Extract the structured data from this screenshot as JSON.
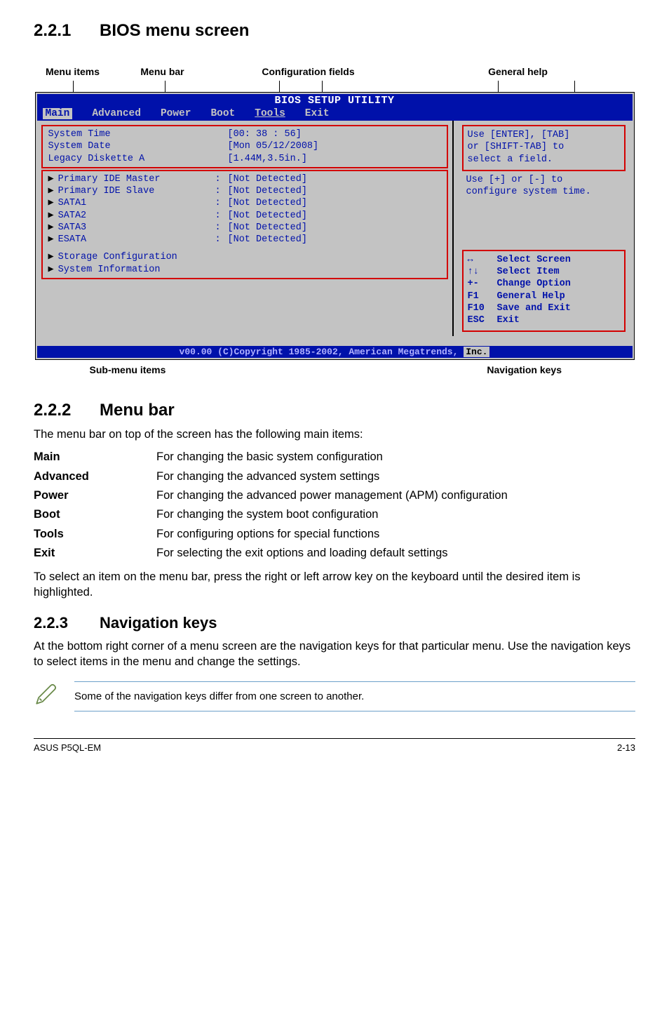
{
  "section_221": {
    "num": "2.2.1",
    "title": "BIOS menu screen"
  },
  "labels_top": {
    "menu_items": "Menu items",
    "menu_bar": "Menu bar",
    "config_fields": "Configuration fields",
    "general_help": "General help"
  },
  "bios": {
    "title": "BIOS SETUP UTILITY",
    "menubar": [
      "Main",
      "Advanced",
      "Power",
      "Boot",
      "Tools",
      "Exit"
    ],
    "left_group1": [
      {
        "k": "System Time",
        "v": "[00: 38 : 56]",
        "c": ""
      },
      {
        "k": "System Date",
        "v": "[Mon 05/12/2008]",
        "c": ""
      },
      {
        "k": "Legacy Diskette A",
        "v": "[1.44M,3.5in.]",
        "c": ""
      }
    ],
    "left_group2": [
      {
        "k": "Primary IDE Master",
        "v": "[Not Detected]",
        "arrow": true,
        "c": ":"
      },
      {
        "k": "Primary IDE Slave",
        "v": "[Not Detected]",
        "arrow": true,
        "c": ":"
      },
      {
        "k": "SATA1",
        "v": "[Not Detected]",
        "arrow": true,
        "c": ":"
      },
      {
        "k": "SATA2",
        "v": "[Not Detected]",
        "arrow": true,
        "c": ":"
      },
      {
        "k": "SATA3",
        "v": "[Not Detected]",
        "arrow": true,
        "c": ":"
      },
      {
        "k": "ESATA",
        "v": "[Not Detected]",
        "arrow": true,
        "c": ":"
      }
    ],
    "left_group3": [
      {
        "k": "Storage Configuration",
        "arrow": true
      },
      {
        "k": "System Information",
        "arrow": true
      }
    ],
    "help1": [
      "Use [ENTER], [TAB]",
      "or [SHIFT-TAB] to",
      "select a field."
    ],
    "help2": [
      "Use [+] or [-] to",
      "configure system time."
    ],
    "keys": [
      {
        "sym": "↔",
        "label": "Select Screen"
      },
      {
        "sym": "↑↓",
        "label": "Select Item"
      },
      {
        "sym": "+-",
        "label": "Change Option"
      },
      {
        "sym": "F1",
        "label": "General Help"
      },
      {
        "sym": "F10",
        "label": "Save and Exit"
      },
      {
        "sym": "ESC",
        "label": "Exit"
      }
    ],
    "copyright_pre": "v00.00 (C)Copyright 1985-2002, American Megatrends, ",
    "copyright_inc": "Inc."
  },
  "labels_bottom": {
    "sub_menu": "Sub-menu items",
    "nav_keys": "Navigation keys"
  },
  "section_222": {
    "num": "2.2.2",
    "title": "Menu bar",
    "intro": "The menu bar on top of the screen has the following main items:",
    "defs": [
      {
        "term": "Main",
        "desc": "For changing the basic system configuration"
      },
      {
        "term": "Advanced",
        "desc": "For changing the advanced system settings"
      },
      {
        "term": "Power",
        "desc": "For changing the advanced power management (APM) configuration"
      },
      {
        "term": "Boot",
        "desc": "For changing the system boot configuration"
      },
      {
        "term": "Tools",
        "desc": "For configuring options for special functions"
      },
      {
        "term": "Exit",
        "desc": "For selecting the exit options and loading default settings"
      }
    ],
    "outro": "To select an item on the menu bar, press the right or left arrow key on the keyboard until the desired item is highlighted."
  },
  "section_223": {
    "num": "2.2.3",
    "title": "Navigation keys",
    "body": "At the bottom right corner of a menu screen are the navigation keys for that particular menu. Use the navigation keys to select items in the menu and change the settings.",
    "note": "Some of the navigation keys differ from one screen to another."
  },
  "footer": {
    "left": "ASUS P5QL-EM",
    "right": "2-13"
  }
}
